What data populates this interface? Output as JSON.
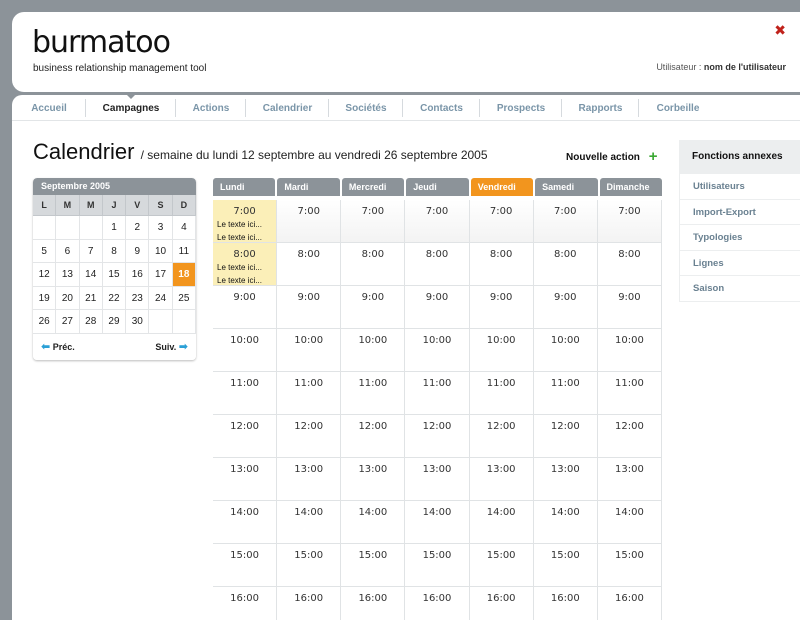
{
  "header": {
    "logo": "burmatoo",
    "tagline": "business relationship management tool",
    "user_label": "Utilisateur :",
    "user_name": "nom de l'utilisateur",
    "close_symbol": "✖"
  },
  "nav": {
    "items": [
      {
        "label": "Accueil",
        "width": 74
      },
      {
        "label": "Campagnes",
        "width": 90,
        "active": true
      },
      {
        "label": "Actions",
        "width": 70
      },
      {
        "label": "Calendrier",
        "width": 83
      },
      {
        "label": "Sociétés",
        "width": 74
      },
      {
        "label": "Contacts",
        "width": 77
      },
      {
        "label": "Prospects",
        "width": 82
      },
      {
        "label": "Rapports",
        "width": 77
      },
      {
        "label": "Corbeille",
        "width": 78
      }
    ]
  },
  "title": {
    "main": "Calendrier",
    "subtitle": "/ semaine du lundi 12 septembre au vendredi 26 septembre 2005"
  },
  "new_action": {
    "label": "Nouvelle action",
    "icon_symbol": "+"
  },
  "mini_calendar": {
    "month_label": "Septembre 2005",
    "weekdays": [
      "L",
      "M",
      "M",
      "J",
      "V",
      "S",
      "D"
    ],
    "weeks": [
      [
        "",
        "",
        "",
        "1",
        "2",
        "3",
        "4"
      ],
      [
        "5",
        "6",
        "7",
        "8",
        "9",
        "10",
        "11"
      ],
      [
        "12",
        "13",
        "14",
        "15",
        "16",
        "17",
        "18"
      ],
      [
        "19",
        "20",
        "21",
        "22",
        "23",
        "24",
        "25"
      ],
      [
        "26",
        "27",
        "28",
        "29",
        "30",
        "",
        ""
      ]
    ],
    "today": "18",
    "prev_label": "Préc.",
    "next_label": "Suiv.",
    "prev_arrow": "⬅",
    "next_arrow": "➡"
  },
  "week": {
    "days": [
      {
        "label": "Lundi"
      },
      {
        "label": "Mardi"
      },
      {
        "label": "Mercredi"
      },
      {
        "label": "Jeudi"
      },
      {
        "label": "Vendredi",
        "today": true
      },
      {
        "label": "Samedi"
      },
      {
        "label": "Dimanche"
      }
    ],
    "hours": [
      "7:00",
      "8:00",
      "9:00",
      "10:00",
      "11:00",
      "12:00",
      "13:00",
      "14:00",
      "15:00",
      "16:00"
    ],
    "events": [
      {
        "day": 0,
        "hour": "7:00",
        "lines": [
          "Le texte ici...",
          "Le texte ici..."
        ]
      },
      {
        "day": 0,
        "hour": "8:00",
        "lines": [
          "Le texte ici...",
          "Le texte ici..."
        ]
      }
    ]
  },
  "sidebar": {
    "title": "Fonctions annexes",
    "items": [
      "Utilisateurs",
      "Import-Export",
      "Typologies",
      "Lignes",
      "Saison"
    ]
  },
  "colors": {
    "accent": "#f2951e",
    "header_grey": "#8c9399",
    "event": "#fbefb8",
    "link": "#6a8191"
  }
}
